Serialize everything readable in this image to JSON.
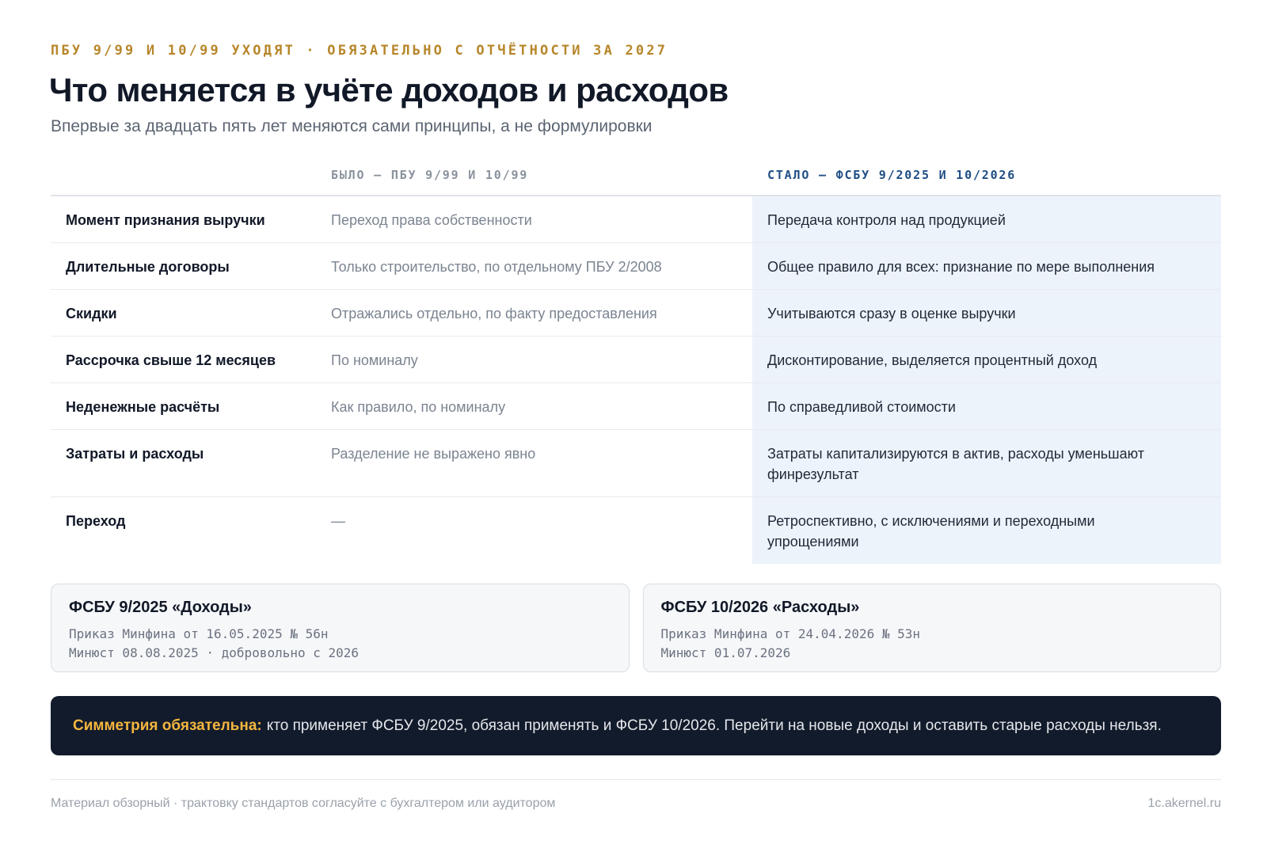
{
  "header": {
    "kicker": "ПБУ 9/99 И 10/99 УХОДЯТ · ОБЯЗАТЕЛЬНО С ОТЧЁТНОСТИ ЗА 2027",
    "title": "Что меняется в учёте доходов и расходов",
    "subtitle": "Впервые за двадцать пять лет меняются сами принципы, а не формулировки"
  },
  "table": {
    "head": {
      "old": "БЫЛО — ПБУ 9/99 И 10/99",
      "new": "СТАЛО — ФСБУ 9/2025 И 10/2026"
    },
    "rows": [
      {
        "label": "Момент признания выручки",
        "old": "Переход права собственности",
        "new": "Передача контроля над продукцией"
      },
      {
        "label": "Длительные договоры",
        "old": "Только строительство, по отдельному ПБУ 2/2008",
        "new": "Общее правило для всех: признание по мере выполнения"
      },
      {
        "label": "Скидки",
        "old": "Отражались отдельно, по факту предоставления",
        "new": "Учитываются сразу в оценке выручки"
      },
      {
        "label": "Рассрочка свыше 12 месяцев",
        "old": "По номиналу",
        "new": "Дисконтирование, выделяется процентный доход"
      },
      {
        "label": "Неденежные расчёты",
        "old": "Как правило, по номиналу",
        "new": "По справедливой стоимости"
      },
      {
        "label": "Затраты и расходы",
        "old": "Разделение не выражено явно",
        "new": "Затраты капитализируются в актив, расходы уменьшают финрезультат"
      },
      {
        "label": "Переход",
        "old": "—",
        "new": "Ретроспективно, с исключениями и переходными упрощениями"
      }
    ]
  },
  "cards": [
    {
      "title": "ФСБУ 9/2025 «Доходы»",
      "line1": "Приказ Минфина от 16.05.2025 № 56н",
      "line2": "Минюст 08.08.2025 · добровольно с 2026"
    },
    {
      "title": "ФСБУ 10/2026 «Расходы»",
      "line1": "Приказ Минфина от 24.04.2026 № 53н",
      "line2": "Минюст 01.07.2026"
    }
  ],
  "banner": {
    "emphasis": "Симметрия обязательна:",
    "text": "кто применяет ФСБУ 9/2025, обязан применять и ФСБУ 10/2026. Перейти на новые доходы и оставить старые расходы нельзя."
  },
  "footer": {
    "note": "Материал обзорный · трактовку стандартов согласуйте с бухгалтером или аудитором",
    "site": "1c.akernel.ru"
  },
  "colors": {
    "accent": "#b7862a",
    "new_header": "#1f4e85",
    "new_column_bg": "#edf3fa",
    "banner_bg": "#121b2b",
    "banner_emphasis": "#f4b63f"
  }
}
